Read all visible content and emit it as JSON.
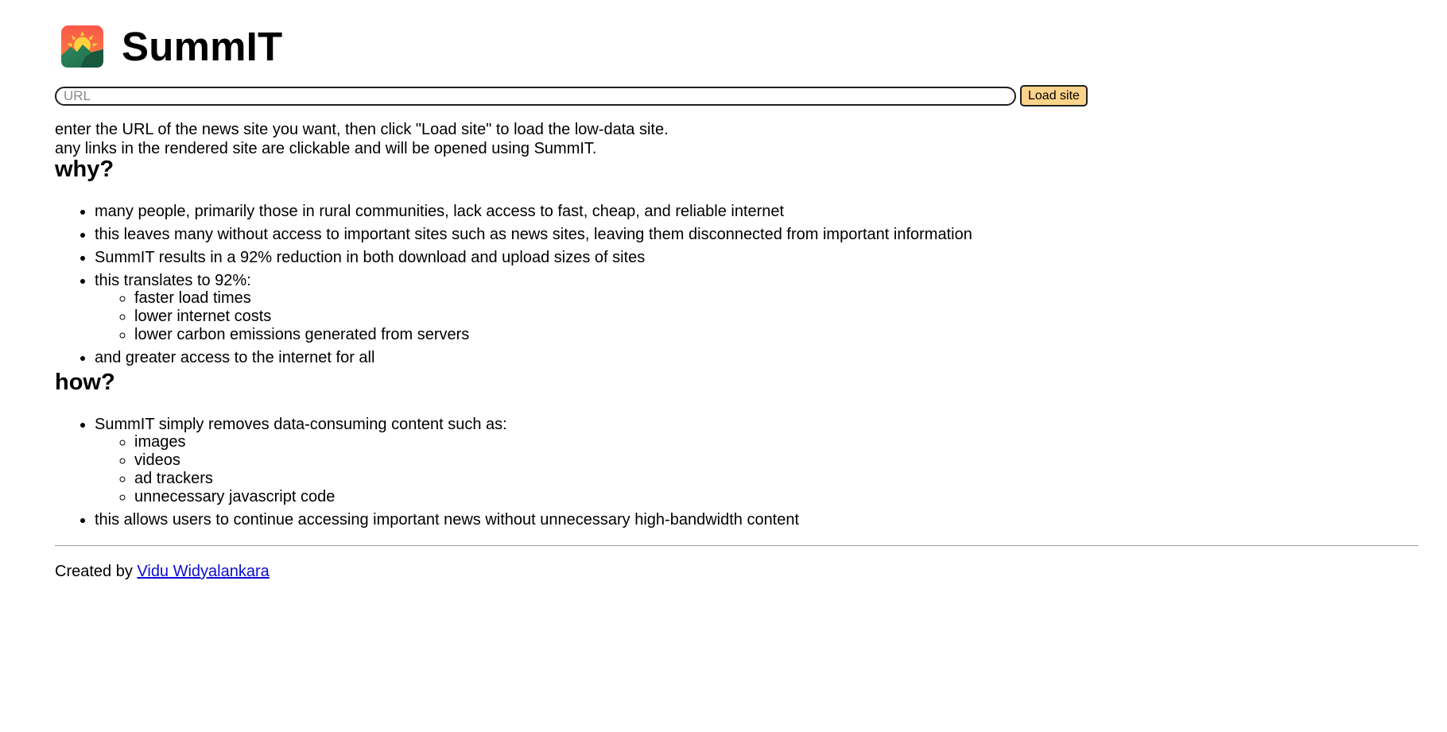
{
  "header": {
    "title": "SummIT",
    "logo_icon": "mountain-sunrise-logo"
  },
  "search": {
    "placeholder": "URL",
    "value": "",
    "button_label": "Load site",
    "button_color": "#fdd38a"
  },
  "instructions": {
    "line1": "enter the URL of the news site you want, then click \"Load site\" to load the low-data site.",
    "line2": "any links in the rendered site are clickable and will be opened using SummIT."
  },
  "why": {
    "heading": "why?",
    "items": [
      "many people, primarily those in rural communities, lack access to fast, cheap, and reliable internet",
      "this leaves many without access to important sites such as news sites, leaving them disconnected from important information",
      "SummIT results in a 92% reduction in both download and upload sizes of sites",
      "this translates to 92%:",
      "and greater access to the internet for all"
    ],
    "subitems": [
      "faster load times",
      "lower internet costs",
      "lower carbon emissions generated from servers"
    ]
  },
  "how": {
    "heading": "how?",
    "items": [
      "SummIT simply removes data-consuming content such as:",
      "this allows users to continue accessing important news without unnecessary high-bandwidth content"
    ],
    "subitems": [
      "images",
      "videos",
      "ad trackers",
      "unnecessary javascript code"
    ]
  },
  "footer": {
    "prefix": "Created by ",
    "author_link": "Vidu Widyalankara",
    "link_color": "#0b0bd6"
  }
}
